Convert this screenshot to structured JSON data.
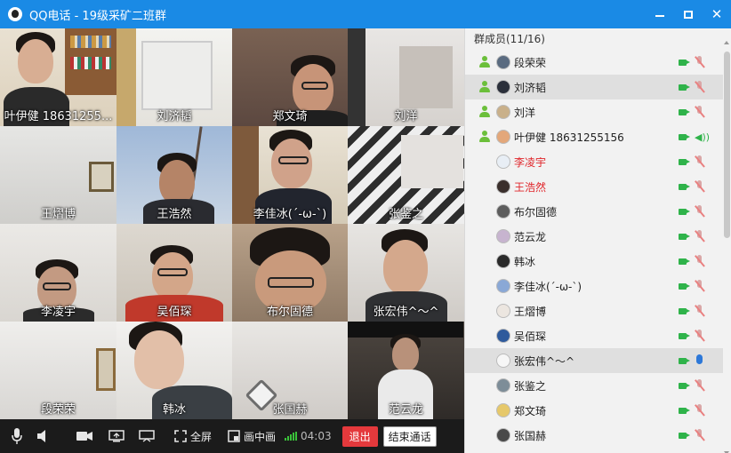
{
  "window": {
    "title": "QQ电话 - 19级采矿二班群",
    "minimize_icon": "minimize-icon",
    "maximize_icon": "maximize-icon",
    "close_label": "✕"
  },
  "video_tiles": [
    {
      "name": "叶伊健 18631255..."
    },
    {
      "name": "刘济韬"
    },
    {
      "name": "郑文琦"
    },
    {
      "name": "刘洋"
    },
    {
      "name": "王熠博"
    },
    {
      "name": "王浩然"
    },
    {
      "name": "李佳冰(´-ω-`)"
    },
    {
      "name": "张鉴之"
    },
    {
      "name": "李凌宇"
    },
    {
      "name": "吴佰琛"
    },
    {
      "name": "布尔固德"
    },
    {
      "name": "张宏伟^～^"
    },
    {
      "name": "段荣荣"
    },
    {
      "name": "韩冰"
    },
    {
      "name": "张国赫"
    },
    {
      "name": "范云龙"
    }
  ],
  "toolbar": {
    "fullscreen_label": "全屏",
    "pip_label": "画中画",
    "timer": "04:03",
    "exit_label": "退出",
    "end_call_label": "结束通话"
  },
  "members": {
    "header": "群成员(11/16)",
    "list": [
      {
        "name": "段荣荣",
        "in_call": true,
        "mic": "muted"
      },
      {
        "name": "刘济韬",
        "in_call": true,
        "mic": "muted"
      },
      {
        "name": "刘洋",
        "in_call": true,
        "mic": "muted"
      },
      {
        "name": "叶伊健 18631255156",
        "in_call": true,
        "mic": "speaking"
      },
      {
        "name": "李凌宇",
        "in_call": false,
        "mic": "muted",
        "color": "#e0262b"
      },
      {
        "name": "王浩然",
        "in_call": false,
        "mic": "muted",
        "color": "#e0262b"
      },
      {
        "name": "布尔固德",
        "in_call": false,
        "mic": "muted"
      },
      {
        "name": "范云龙",
        "in_call": false,
        "mic": "muted"
      },
      {
        "name": "韩冰",
        "in_call": false,
        "mic": "muted"
      },
      {
        "name": "李佳冰(´-ω-`)",
        "in_call": false,
        "mic": "muted"
      },
      {
        "name": "王熠博",
        "in_call": false,
        "mic": "muted"
      },
      {
        "name": "吴佰琛",
        "in_call": false,
        "mic": "muted"
      },
      {
        "name": "张宏伟^～^",
        "in_call": false,
        "mic": "active"
      },
      {
        "name": "张鉴之",
        "in_call": false,
        "mic": "muted"
      },
      {
        "name": "郑文琦",
        "in_call": false,
        "mic": "muted"
      },
      {
        "name": "张国赫",
        "in_call": false,
        "mic": "muted"
      }
    ]
  },
  "colors": {
    "titlebar": "#1a8ae5",
    "camera_on": "#2fb34a",
    "exit_button": "#e4393c",
    "owner_name": "#e0262b"
  }
}
